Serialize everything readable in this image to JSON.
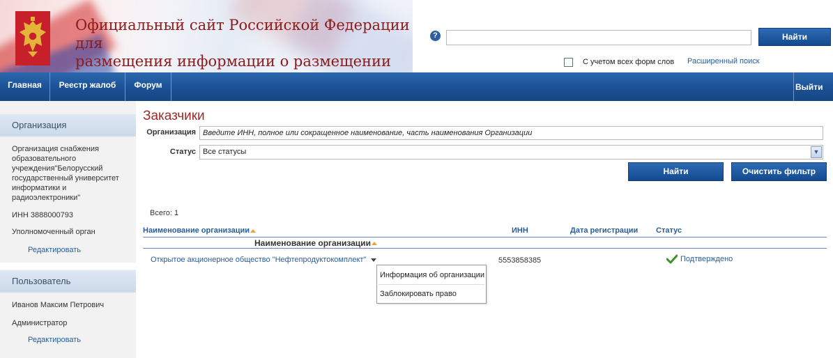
{
  "header": {
    "site_title_line1": "Официальный сайт Российской Федерации для",
    "site_title_line2": "размещения информации о размещении заказов",
    "help_icon": "?",
    "search_value": "",
    "search_button": "Найти",
    "wordforms_label": "С учетом всех форм слов",
    "wordforms_checked": false,
    "advanced_search": "Расширенный поиск"
  },
  "nav": {
    "items": [
      {
        "label": "Главная"
      },
      {
        "label": "Реестр жалоб"
      },
      {
        "label": "Форум"
      }
    ],
    "logout": "Выйти"
  },
  "sidebar": {
    "org_header": "Организация",
    "org_name": "Организация снабжения образовательного учреждения\"Белорусский государственный университет информатики и радиоэлектроники\"",
    "org_inn": "ИНН 3888000793",
    "org_role": "Уполномоченный орган",
    "org_edit": "Редактировать",
    "user_header": "Пользователь",
    "user_name": "Иванов Максим Петрович",
    "user_role": "Администратор",
    "user_edit": "Редактировать"
  },
  "main": {
    "title": "Заказчики",
    "filter": {
      "org_label": "Организация",
      "org_placeholder": "Введите ИНН, полное или сокращенное наименование, часть наименования Организации",
      "status_label": "Статус",
      "status_value": "Все статусы",
      "find_button": "Найти",
      "clear_button": "Очистить фильтр"
    },
    "total": "Всего: 1",
    "columns": {
      "name": "Наименование организации",
      "inn": "ИНН",
      "reg_date": "Дата регистрации",
      "status": "Статус"
    },
    "group_header": "Наименование организации",
    "rows": [
      {
        "name": "Открытое акционерное общество \"Нефтепродуктокомплект\"",
        "inn": "5553858385",
        "reg_date": "",
        "status": "Подтверждено"
      }
    ],
    "context_menu": {
      "items": [
        {
          "label": "Информация об организации"
        },
        {
          "label": "Заблокировать право"
        }
      ]
    }
  },
  "colors": {
    "nav_blue": "#1a4f93",
    "title_red": "#9b2a2a",
    "link_blue": "#2a5d9a",
    "status_green": "#3f8f2a"
  }
}
